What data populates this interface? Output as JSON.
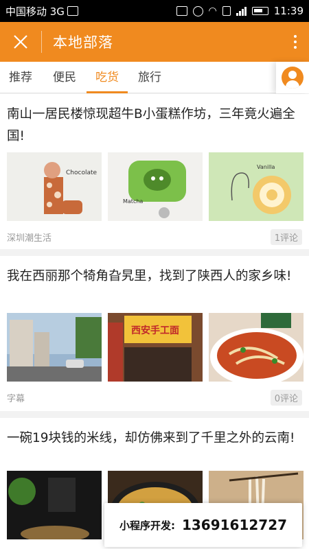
{
  "status_bar": {
    "carrier": "中国移动 3G",
    "network": "3G",
    "time": "11:39"
  },
  "app_bar": {
    "title": "本地部落",
    "close_icon": "close-icon",
    "more_icon": "more-vertical-icon"
  },
  "tabs": [
    {
      "label": "推荐",
      "active": false
    },
    {
      "label": "便民",
      "active": false
    },
    {
      "label": "吃货",
      "active": true
    },
    {
      "label": "旅行",
      "active": false
    }
  ],
  "avatar_icon": "user-avatar-icon",
  "colors": {
    "accent": "#f08a1f",
    "text": "#222222",
    "muted": "#999999"
  },
  "articles": [
    {
      "title": "南山一居民楼惊现超牛B小蛋糕作坊，三年竟火遍全国!",
      "source": "深圳潮生活",
      "comments": "1评论",
      "images": [
        {
          "caption": "Chocolate"
        },
        {
          "caption": "Matcha"
        },
        {
          "caption": "Vanilla"
        }
      ]
    },
    {
      "title": "我在西丽那个犄角旮旯里，找到了陕西人的家乡味!",
      "source": "字幕",
      "comments": "0评论",
      "images": [
        {
          "caption": ""
        },
        {
          "caption": "西安手工面"
        },
        {
          "caption": ""
        }
      ]
    },
    {
      "title": "一碗19块钱的米线，却仿佛来到了千里之外的云南!",
      "images": [
        {
          "caption": ""
        },
        {
          "caption": ""
        },
        {
          "caption": ""
        }
      ]
    }
  ],
  "overlay": {
    "label": "小程序开发:",
    "phone": "13691612727"
  }
}
